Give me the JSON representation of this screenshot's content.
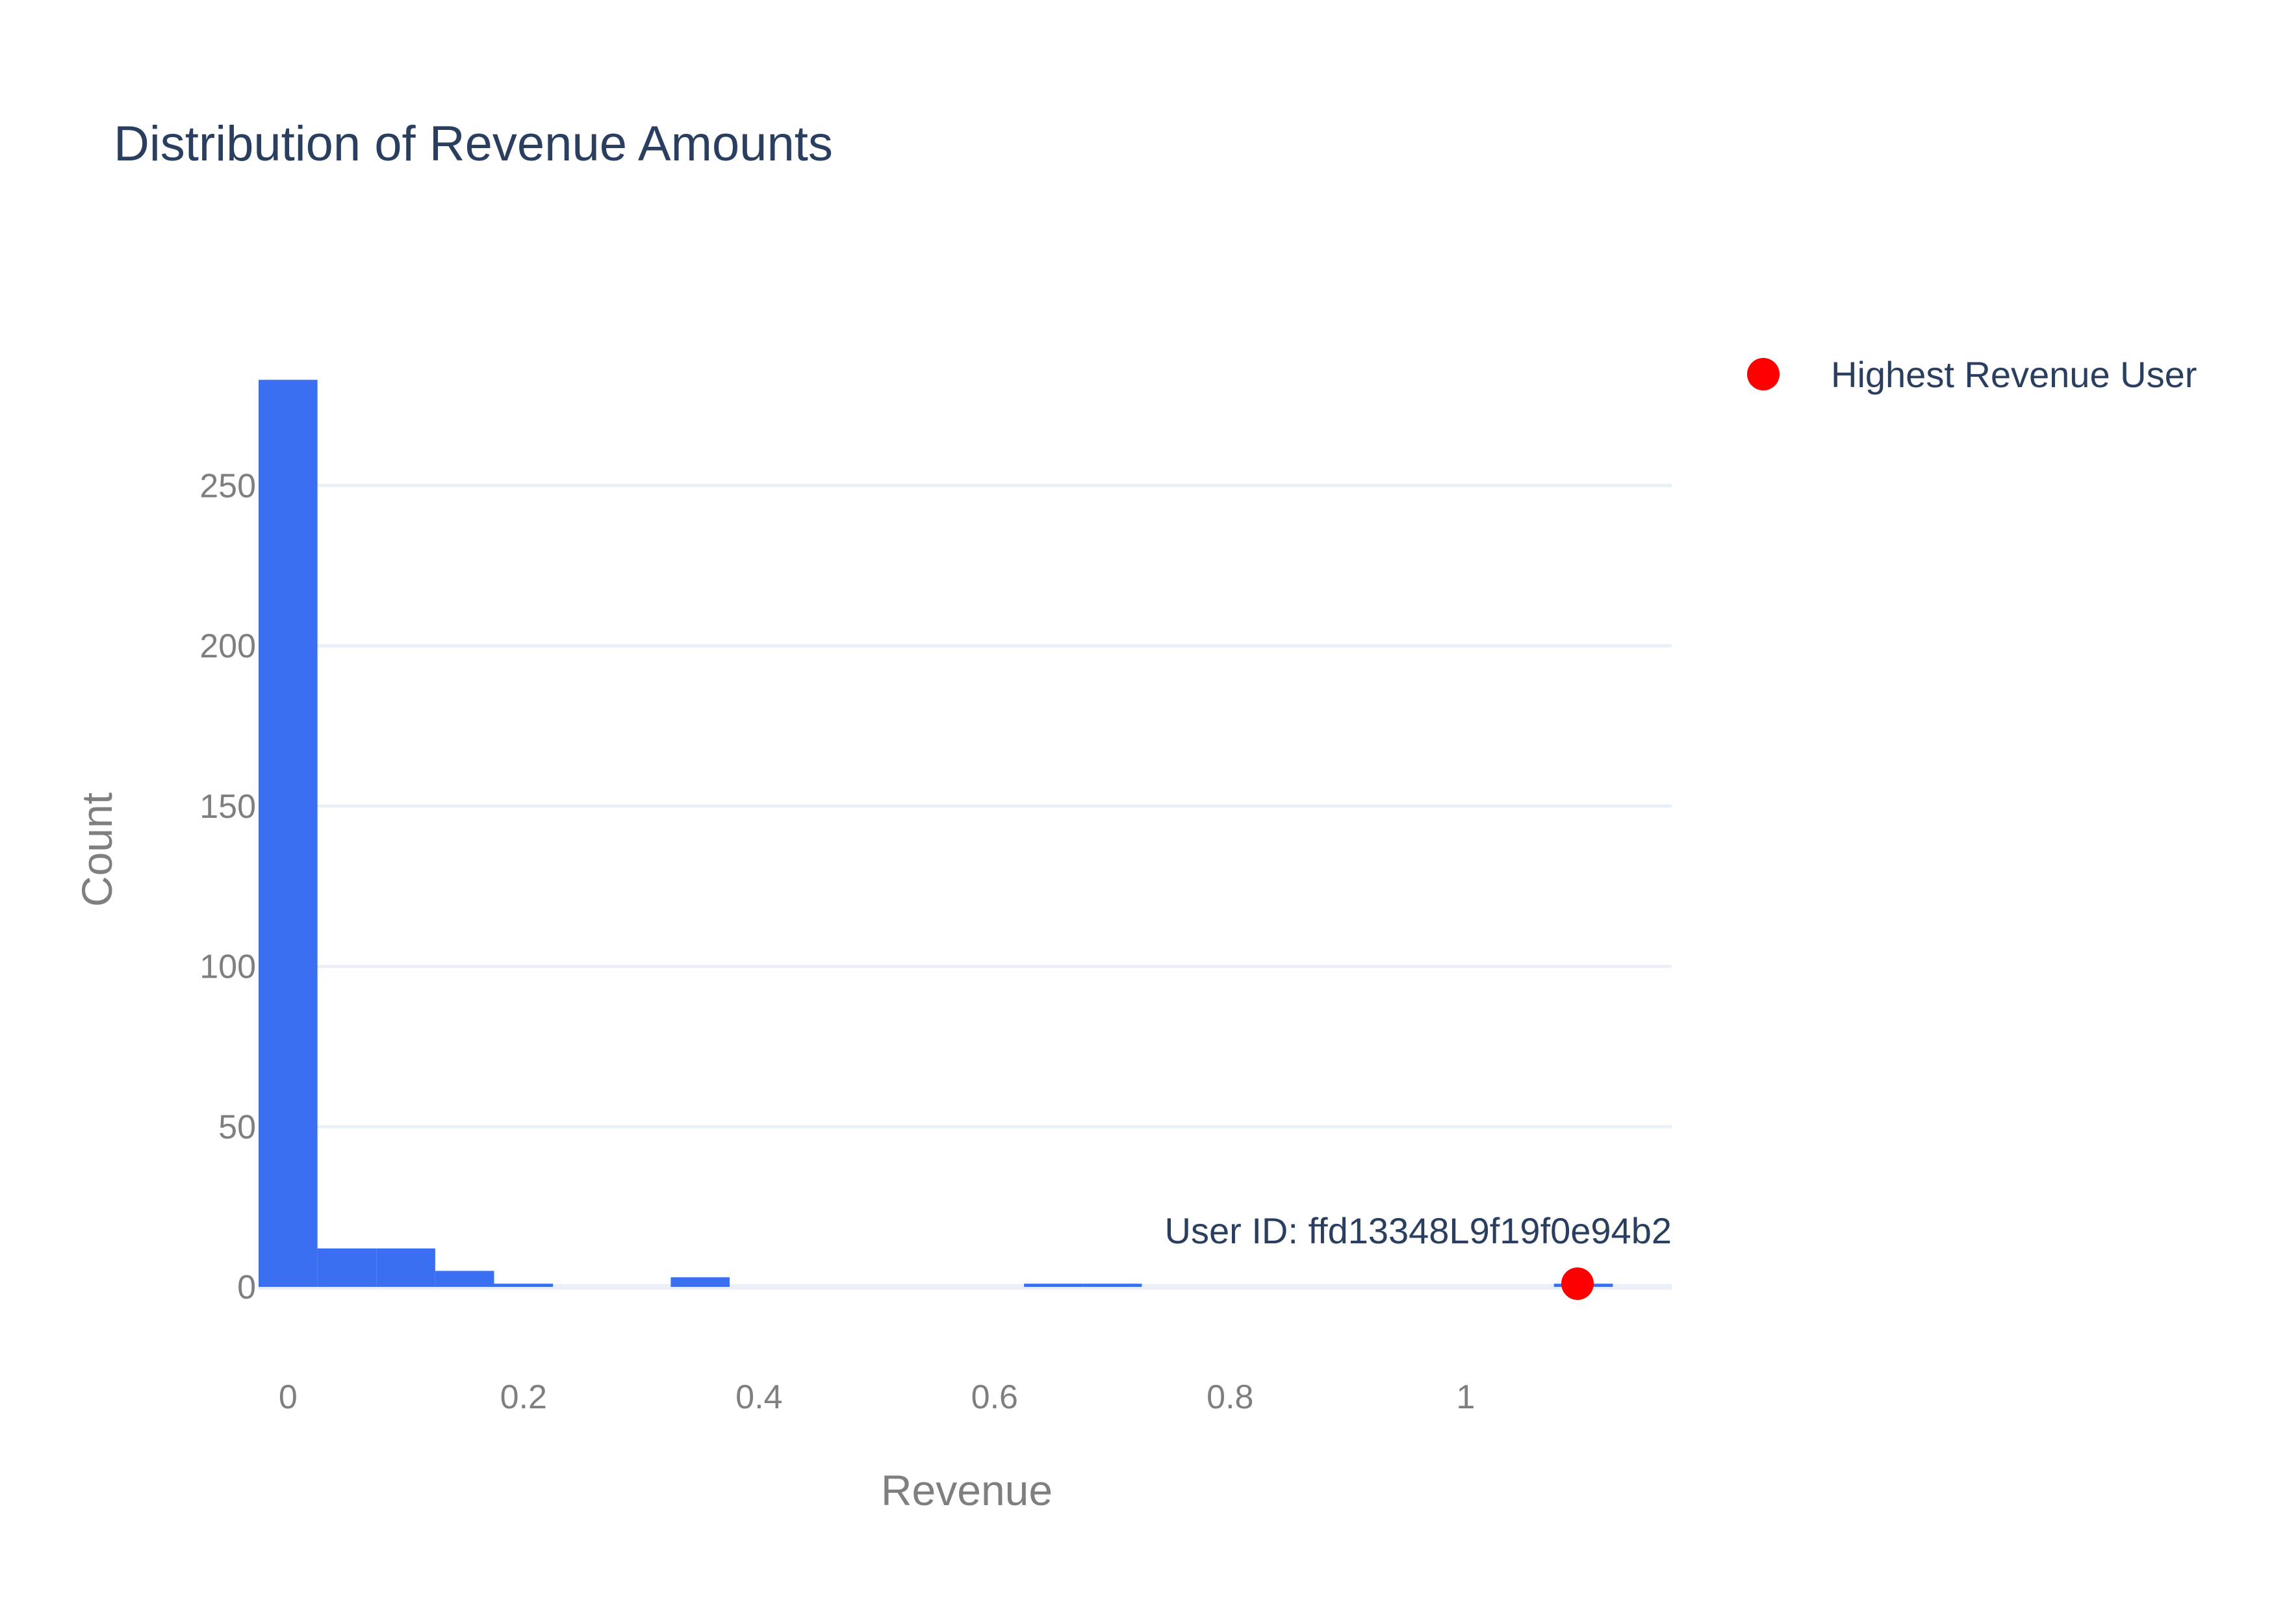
{
  "chart_data": {
    "type": "bar",
    "title": "Distribution of Revenue Amounts",
    "xlabel": "Revenue",
    "ylabel": "Count",
    "xlim": [
      -0.025,
      1.175
    ],
    "ylim": [
      -16,
      288
    ],
    "x_ticks": [
      {
        "value": 0,
        "label": "0"
      },
      {
        "value": 0.2,
        "label": "0.2"
      },
      {
        "value": 0.4,
        "label": "0.4"
      },
      {
        "value": 0.6,
        "label": "0.6"
      },
      {
        "value": 0.8,
        "label": "0.8"
      },
      {
        "value": 1,
        "label": "1"
      }
    ],
    "y_ticks": [
      {
        "value": 0,
        "label": "0"
      },
      {
        "value": 50,
        "label": "50"
      },
      {
        "value": 100,
        "label": "100"
      },
      {
        "value": 150,
        "label": "150"
      },
      {
        "value": 200,
        "label": "200"
      },
      {
        "value": 250,
        "label": "250"
      }
    ],
    "grid": true,
    "bin_width": 0.05,
    "bins": [
      {
        "x0": -0.025,
        "x1": 0.025,
        "count": 283
      },
      {
        "x0": 0.025,
        "x1": 0.075,
        "count": 12
      },
      {
        "x0": 0.075,
        "x1": 0.125,
        "count": 12
      },
      {
        "x0": 0.125,
        "x1": 0.175,
        "count": 5
      },
      {
        "x0": 0.175,
        "x1": 0.225,
        "count": 1
      },
      {
        "x0": 0.325,
        "x1": 0.375,
        "count": 3
      },
      {
        "x0": 0.625,
        "x1": 0.675,
        "count": 1
      },
      {
        "x0": 0.675,
        "x1": 0.725,
        "count": 1
      },
      {
        "x0": 1.075,
        "x1": 1.125,
        "count": 1
      }
    ],
    "bar_color": "#3a6ff2",
    "highlight": {
      "name": "Highest Revenue User",
      "x": 1.095,
      "y": 1,
      "color": "#ff0000",
      "annotation": "User ID: ffd13348L9f19f0e94b2"
    },
    "legend_position": "top-right"
  }
}
